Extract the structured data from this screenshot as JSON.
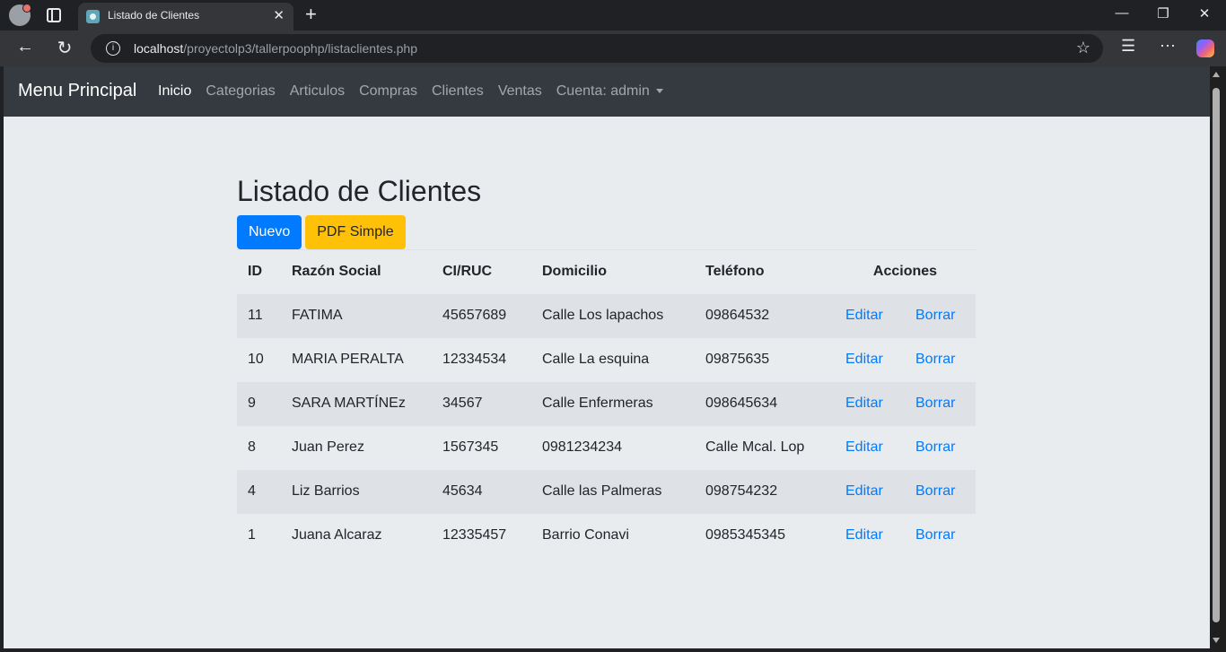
{
  "browser": {
    "tab_title": "Listado de Clientes",
    "url_host": "localhost",
    "url_path": "/proyectolp3/tallerpoophp/listaclientes.php"
  },
  "navbar": {
    "brand": "Menu Principal",
    "links": [
      "Inicio",
      "Categorias",
      "Articulos",
      "Compras",
      "Clientes",
      "Ventas",
      "Cuenta: admin"
    ]
  },
  "main": {
    "title": "Listado de Clientes",
    "new_button": "Nuevo",
    "pdf_button": "PDF Simple",
    "columns": [
      "ID",
      "Razón Social",
      "CI/RUC",
      "Domicilio",
      "Teléfono",
      "Acciones"
    ],
    "edit_label": "Editar",
    "delete_label": "Borrar",
    "rows": [
      [
        "11",
        "FATIMA",
        "45657689",
        "Calle Los lapachos",
        "09864532"
      ],
      [
        "10",
        "MARIA PERALTA",
        "12334534",
        "Calle La esquina",
        "09875635"
      ],
      [
        "9",
        "SARA MARTÍNEz",
        "34567",
        "Calle Enfermeras",
        "098645634"
      ],
      [
        "8",
        "Juan Perez",
        "1567345",
        "0981234234",
        "Calle Mcal. Lop"
      ],
      [
        "4",
        "Liz Barrios",
        "45634",
        "Calle las Palmeras",
        "098754232"
      ],
      [
        "1",
        "Juana Alcaraz",
        "12335457",
        "Barrio Conavi",
        "0985345345"
      ]
    ]
  },
  "colors": {
    "navbar_bg": "#343a40",
    "primary": "#007bff",
    "warning": "#ffc107",
    "page_bg": "#e9ecef"
  }
}
